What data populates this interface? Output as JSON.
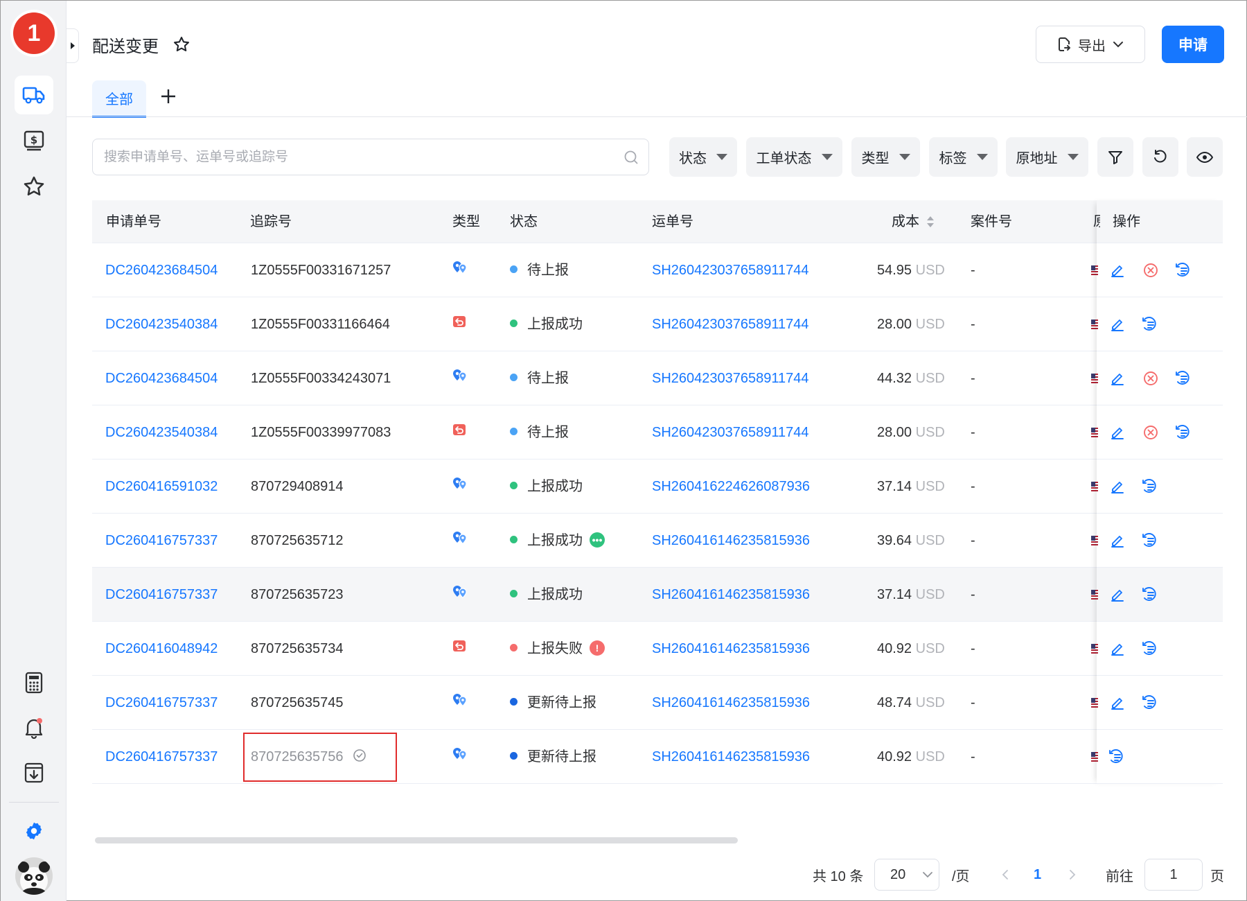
{
  "logo": {
    "text": "1"
  },
  "header": {
    "title": "配送变更",
    "export_label": "导出",
    "apply_label": "申请"
  },
  "tabs": [
    {
      "label": "全部",
      "active": true
    }
  ],
  "search": {
    "placeholder": "搜索申请单号、运单号或追踪号",
    "value": ""
  },
  "filters": [
    "状态",
    "工单状态",
    "类型",
    "标签",
    "原地址"
  ],
  "table": {
    "columns": {
      "request_no": "申请单号",
      "tracking_no": "追踪号",
      "type": "类型",
      "status": "状态",
      "waybill_no": "运单号",
      "cost": "成本",
      "case_no": "案件号",
      "origin": "原",
      "actions": "操作"
    },
    "rows": [
      {
        "request_no": "DC260423684504",
        "tracking_no": "1Z0555F00331671257",
        "type": "address",
        "status": "待上报",
        "status_color": "#4aa3f5",
        "waybill_no": "SH260423037658911744",
        "cost": "54.95",
        "currency": "USD",
        "case_no": "-",
        "actions": [
          "edit",
          "cancel",
          "history"
        ]
      },
      {
        "request_no": "DC260423540384",
        "tracking_no": "1Z0555F00331166464",
        "type": "return",
        "status": "上报成功",
        "status_color": "#2fc27e",
        "waybill_no": "SH260423037658911744",
        "cost": "28.00",
        "currency": "USD",
        "case_no": "-",
        "actions": [
          "edit",
          "history"
        ]
      },
      {
        "request_no": "DC260423684504",
        "tracking_no": "1Z0555F00334243071",
        "type": "address",
        "status": "待上报",
        "status_color": "#4aa3f5",
        "waybill_no": "SH260423037658911744",
        "cost": "44.32",
        "currency": "USD",
        "case_no": "-",
        "actions": [
          "edit",
          "cancel",
          "history"
        ]
      },
      {
        "request_no": "DC260423540384",
        "tracking_no": "1Z0555F00339977083",
        "type": "return",
        "status": "待上报",
        "status_color": "#4aa3f5",
        "waybill_no": "SH260423037658911744",
        "cost": "28.00",
        "currency": "USD",
        "case_no": "-",
        "actions": [
          "edit",
          "cancel",
          "history"
        ]
      },
      {
        "request_no": "DC260416591032",
        "tracking_no": "870729408914",
        "type": "address",
        "status": "上报成功",
        "status_color": "#2fc27e",
        "waybill_no": "SH260416224626087936",
        "cost": "37.14",
        "currency": "USD",
        "case_no": "-",
        "actions": [
          "edit",
          "history"
        ]
      },
      {
        "request_no": "DC260416757337",
        "tracking_no": "870725635712",
        "type": "address",
        "status": "上报成功",
        "status_color": "#2fc27e",
        "badge": "more",
        "waybill_no": "SH260416146235815936",
        "cost": "39.64",
        "currency": "USD",
        "case_no": "-",
        "actions": [
          "edit",
          "history"
        ]
      },
      {
        "request_no": "DC260416757337",
        "tracking_no": "870725635723",
        "type": "address",
        "status": "上报成功",
        "status_color": "#2fc27e",
        "waybill_no": "SH260416146235815936",
        "cost": "37.14",
        "currency": "USD",
        "case_no": "-",
        "actions": [
          "edit",
          "history"
        ],
        "highlight": true
      },
      {
        "request_no": "DC260416048942",
        "tracking_no": "870725635734",
        "type": "return",
        "status": "上报失败",
        "status_color": "#f56c6c",
        "badge": "error",
        "waybill_no": "SH260416146235815936",
        "cost": "40.92",
        "currency": "USD",
        "case_no": "-",
        "actions": [
          "edit",
          "history"
        ]
      },
      {
        "request_no": "DC260416757337",
        "tracking_no": "870725635745",
        "type": "address",
        "status": "更新待上报",
        "status_color": "#1a66e0",
        "waybill_no": "SH260416146235815936",
        "cost": "48.74",
        "currency": "USD",
        "case_no": "-",
        "actions": [
          "edit",
          "history"
        ]
      },
      {
        "request_no": "DC260416757337",
        "tracking_no": "870725635756",
        "tracking_muted": true,
        "type": "address",
        "status": "更新待上报",
        "status_color": "#1a66e0",
        "waybill_no": "SH260416146235815936",
        "cost": "40.92",
        "currency": "USD",
        "case_no": "-",
        "actions": [
          "history"
        ]
      }
    ]
  },
  "pagination": {
    "total_label": "共 10 条",
    "page_size": "20",
    "per_page_label": "/页",
    "current_page": "1",
    "goto_label": "前往",
    "goto_value": "1",
    "page_suffix": "页"
  },
  "colors": {
    "accent": "#1677ff",
    "logo": "#e8392c",
    "highlight_box": "#e02b2b"
  }
}
